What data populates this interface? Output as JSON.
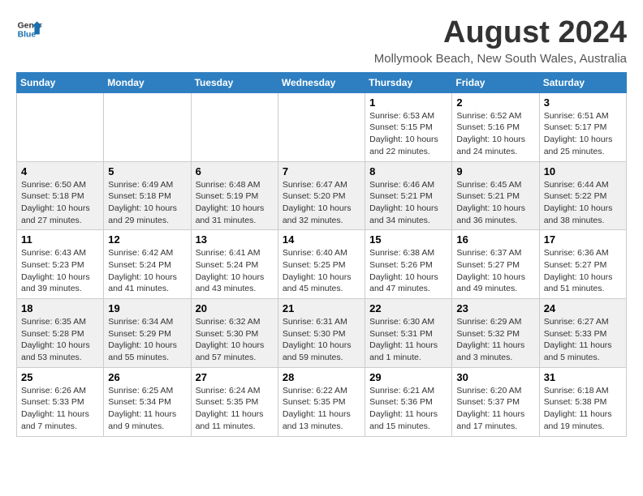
{
  "header": {
    "logo_line1": "General",
    "logo_line2": "Blue",
    "title": "August 2024",
    "subtitle": "Mollymook Beach, New South Wales, Australia"
  },
  "calendar": {
    "days_of_week": [
      "Sunday",
      "Monday",
      "Tuesday",
      "Wednesday",
      "Thursday",
      "Friday",
      "Saturday"
    ],
    "weeks": [
      {
        "row_class": "row-odd",
        "days": [
          {
            "number": "",
            "info": ""
          },
          {
            "number": "",
            "info": ""
          },
          {
            "number": "",
            "info": ""
          },
          {
            "number": "",
            "info": ""
          },
          {
            "number": "1",
            "info": "Sunrise: 6:53 AM\nSunset: 5:15 PM\nDaylight: 10 hours\nand 22 minutes."
          },
          {
            "number": "2",
            "info": "Sunrise: 6:52 AM\nSunset: 5:16 PM\nDaylight: 10 hours\nand 24 minutes."
          },
          {
            "number": "3",
            "info": "Sunrise: 6:51 AM\nSunset: 5:17 PM\nDaylight: 10 hours\nand 25 minutes."
          }
        ]
      },
      {
        "row_class": "row-even",
        "days": [
          {
            "number": "4",
            "info": "Sunrise: 6:50 AM\nSunset: 5:18 PM\nDaylight: 10 hours\nand 27 minutes."
          },
          {
            "number": "5",
            "info": "Sunrise: 6:49 AM\nSunset: 5:18 PM\nDaylight: 10 hours\nand 29 minutes."
          },
          {
            "number": "6",
            "info": "Sunrise: 6:48 AM\nSunset: 5:19 PM\nDaylight: 10 hours\nand 31 minutes."
          },
          {
            "number": "7",
            "info": "Sunrise: 6:47 AM\nSunset: 5:20 PM\nDaylight: 10 hours\nand 32 minutes."
          },
          {
            "number": "8",
            "info": "Sunrise: 6:46 AM\nSunset: 5:21 PM\nDaylight: 10 hours\nand 34 minutes."
          },
          {
            "number": "9",
            "info": "Sunrise: 6:45 AM\nSunset: 5:21 PM\nDaylight: 10 hours\nand 36 minutes."
          },
          {
            "number": "10",
            "info": "Sunrise: 6:44 AM\nSunset: 5:22 PM\nDaylight: 10 hours\nand 38 minutes."
          }
        ]
      },
      {
        "row_class": "row-odd",
        "days": [
          {
            "number": "11",
            "info": "Sunrise: 6:43 AM\nSunset: 5:23 PM\nDaylight: 10 hours\nand 39 minutes."
          },
          {
            "number": "12",
            "info": "Sunrise: 6:42 AM\nSunset: 5:24 PM\nDaylight: 10 hours\nand 41 minutes."
          },
          {
            "number": "13",
            "info": "Sunrise: 6:41 AM\nSunset: 5:24 PM\nDaylight: 10 hours\nand 43 minutes."
          },
          {
            "number": "14",
            "info": "Sunrise: 6:40 AM\nSunset: 5:25 PM\nDaylight: 10 hours\nand 45 minutes."
          },
          {
            "number": "15",
            "info": "Sunrise: 6:38 AM\nSunset: 5:26 PM\nDaylight: 10 hours\nand 47 minutes."
          },
          {
            "number": "16",
            "info": "Sunrise: 6:37 AM\nSunset: 5:27 PM\nDaylight: 10 hours\nand 49 minutes."
          },
          {
            "number": "17",
            "info": "Sunrise: 6:36 AM\nSunset: 5:27 PM\nDaylight: 10 hours\nand 51 minutes."
          }
        ]
      },
      {
        "row_class": "row-even",
        "days": [
          {
            "number": "18",
            "info": "Sunrise: 6:35 AM\nSunset: 5:28 PM\nDaylight: 10 hours\nand 53 minutes."
          },
          {
            "number": "19",
            "info": "Sunrise: 6:34 AM\nSunset: 5:29 PM\nDaylight: 10 hours\nand 55 minutes."
          },
          {
            "number": "20",
            "info": "Sunrise: 6:32 AM\nSunset: 5:30 PM\nDaylight: 10 hours\nand 57 minutes."
          },
          {
            "number": "21",
            "info": "Sunrise: 6:31 AM\nSunset: 5:30 PM\nDaylight: 10 hours\nand 59 minutes."
          },
          {
            "number": "22",
            "info": "Sunrise: 6:30 AM\nSunset: 5:31 PM\nDaylight: 11 hours\nand 1 minute."
          },
          {
            "number": "23",
            "info": "Sunrise: 6:29 AM\nSunset: 5:32 PM\nDaylight: 11 hours\nand 3 minutes."
          },
          {
            "number": "24",
            "info": "Sunrise: 6:27 AM\nSunset: 5:33 PM\nDaylight: 11 hours\nand 5 minutes."
          }
        ]
      },
      {
        "row_class": "row-odd",
        "days": [
          {
            "number": "25",
            "info": "Sunrise: 6:26 AM\nSunset: 5:33 PM\nDaylight: 11 hours\nand 7 minutes."
          },
          {
            "number": "26",
            "info": "Sunrise: 6:25 AM\nSunset: 5:34 PM\nDaylight: 11 hours\nand 9 minutes."
          },
          {
            "number": "27",
            "info": "Sunrise: 6:24 AM\nSunset: 5:35 PM\nDaylight: 11 hours\nand 11 minutes."
          },
          {
            "number": "28",
            "info": "Sunrise: 6:22 AM\nSunset: 5:35 PM\nDaylight: 11 hours\nand 13 minutes."
          },
          {
            "number": "29",
            "info": "Sunrise: 6:21 AM\nSunset: 5:36 PM\nDaylight: 11 hours\nand 15 minutes."
          },
          {
            "number": "30",
            "info": "Sunrise: 6:20 AM\nSunset: 5:37 PM\nDaylight: 11 hours\nand 17 minutes."
          },
          {
            "number": "31",
            "info": "Sunrise: 6:18 AM\nSunset: 5:38 PM\nDaylight: 11 hours\nand 19 minutes."
          }
        ]
      }
    ]
  }
}
